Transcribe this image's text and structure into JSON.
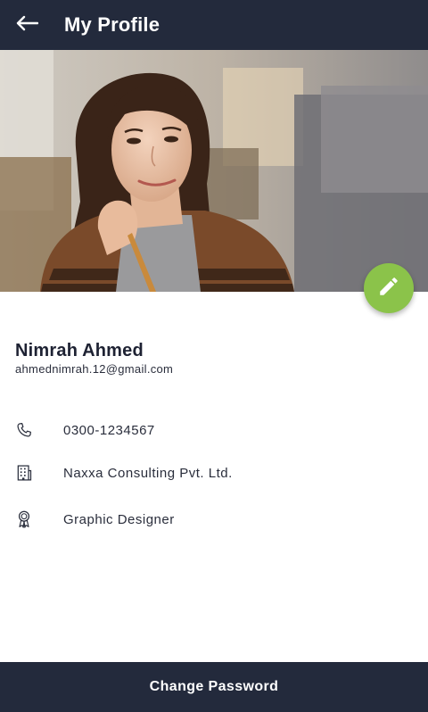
{
  "header": {
    "title": "My Profile",
    "back_icon": "arrow-left-icon",
    "background": "#232a3c"
  },
  "hero": {
    "image_alt": "profile-photo"
  },
  "fab": {
    "icon": "pencil-icon",
    "color": "#8bc34a"
  },
  "profile": {
    "name": "Nimrah Ahmed",
    "email": "ahmednimrah.12@gmail.com"
  },
  "details": [
    {
      "icon": "phone-icon",
      "text": "0300-1234567"
    },
    {
      "icon": "building-icon",
      "text": "Naxxa Consulting Pvt. Ltd."
    },
    {
      "icon": "badge-icon",
      "text": "Graphic Designer"
    }
  ],
  "footer": {
    "button_label": "Change Password",
    "background": "#232a3c"
  }
}
